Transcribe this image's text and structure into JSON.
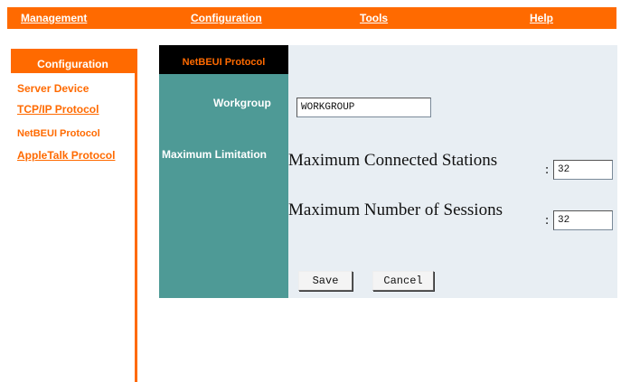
{
  "top_nav": {
    "items": [
      {
        "label": "Management"
      },
      {
        "label": "Configuration"
      },
      {
        "label": "Tools"
      },
      {
        "label": "Help"
      }
    ]
  },
  "sidebar": {
    "header": "Configuration",
    "items": [
      {
        "label": "Server Device"
      },
      {
        "label": "TCP/IP Protocol"
      },
      {
        "label": "NetBEUI Protocol"
      },
      {
        "label": "AppleTalk Protocol"
      }
    ]
  },
  "panel": {
    "title": "NetBEUI Protocol",
    "workgroup_label": "Workgroup",
    "workgroup_value": "WORKGROUP",
    "max_limitation_label": "Maximum Limitation",
    "max_stations_label": "Maximum Connected Stations",
    "max_stations_value": "32",
    "max_sessions_label": "Maximum Number of Sessions",
    "max_sessions_value": "32",
    "colon": ":",
    "save_label": "Save",
    "cancel_label": "Cancel"
  },
  "colors": {
    "accent": "#ff6a00",
    "teal": "#4e9a96",
    "panel_bg": "#e8eef3"
  }
}
